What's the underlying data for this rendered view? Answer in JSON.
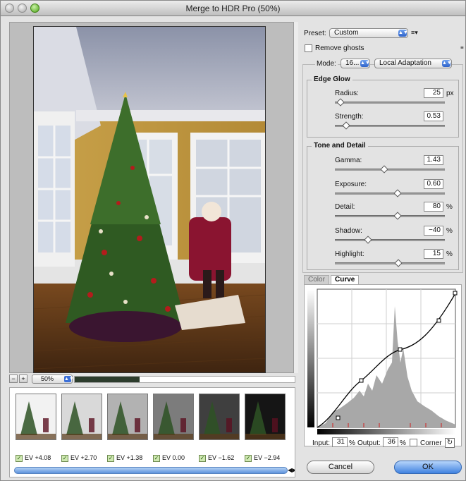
{
  "window": {
    "title": "Merge to HDR Pro (50%)"
  },
  "preview": {
    "zoom": "50%",
    "zoom_out": "−",
    "zoom_in": "+"
  },
  "filmstrip": {
    "thumbs": [
      {
        "label": "EV +4.08",
        "checked": true,
        "tone": "#f2f2f2"
      },
      {
        "label": "EV +2.70",
        "checked": true,
        "tone": "#d9d9d9"
      },
      {
        "label": "EV +1.38",
        "checked": true,
        "tone": "#b2b2b2"
      },
      {
        "label": "EV 0.00",
        "checked": true,
        "tone": "#7c7c7c"
      },
      {
        "label": "EV −1.62",
        "checked": true,
        "tone": "#3f3f3f"
      },
      {
        "label": "EV −2.94",
        "checked": true,
        "tone": "#151515"
      }
    ],
    "check_mark": "✓"
  },
  "controls": {
    "preset_label": "Preset:",
    "preset_value": "Custom",
    "remove_ghosts_label": "Remove ghosts",
    "remove_ghosts_checked": false,
    "mode_label": "Mode:",
    "mode_value": "16...",
    "method_value": "Local Adaptation"
  },
  "edge_glow": {
    "title": "Edge Glow",
    "radius": {
      "label": "Radius:",
      "value": "25",
      "unit": "px",
      "level": 0.05
    },
    "strength": {
      "label": "Strength:",
      "value": "0.53",
      "unit": "",
      "level": 0.1
    }
  },
  "tone_detail": {
    "title": "Tone and Detail",
    "gamma": {
      "label": "Gamma:",
      "value": "1.43",
      "unit": "",
      "level": 0.45
    },
    "exposure": {
      "label": "Exposure:",
      "value": "0.60",
      "unit": "",
      "level": 0.57
    },
    "detail": {
      "label": "Detail:",
      "value": "80",
      "unit": "%",
      "level": 0.57
    },
    "shadow": {
      "label": "Shadow:",
      "value": "−40",
      "unit": "%",
      "level": 0.3
    },
    "highlight": {
      "label": "Highlight:",
      "value": "15",
      "unit": "%",
      "level": 0.58
    }
  },
  "tabs": {
    "color": "Color",
    "curve": "Curve"
  },
  "curve": {
    "input_label": "Input:",
    "input_value": "31",
    "input_unit": "%",
    "output_label": "Output:",
    "output_value": "36",
    "output_unit": "%",
    "corner_label": "Corner",
    "corner_checked": false
  },
  "buttons": {
    "cancel": "Cancel",
    "ok": "OK"
  }
}
